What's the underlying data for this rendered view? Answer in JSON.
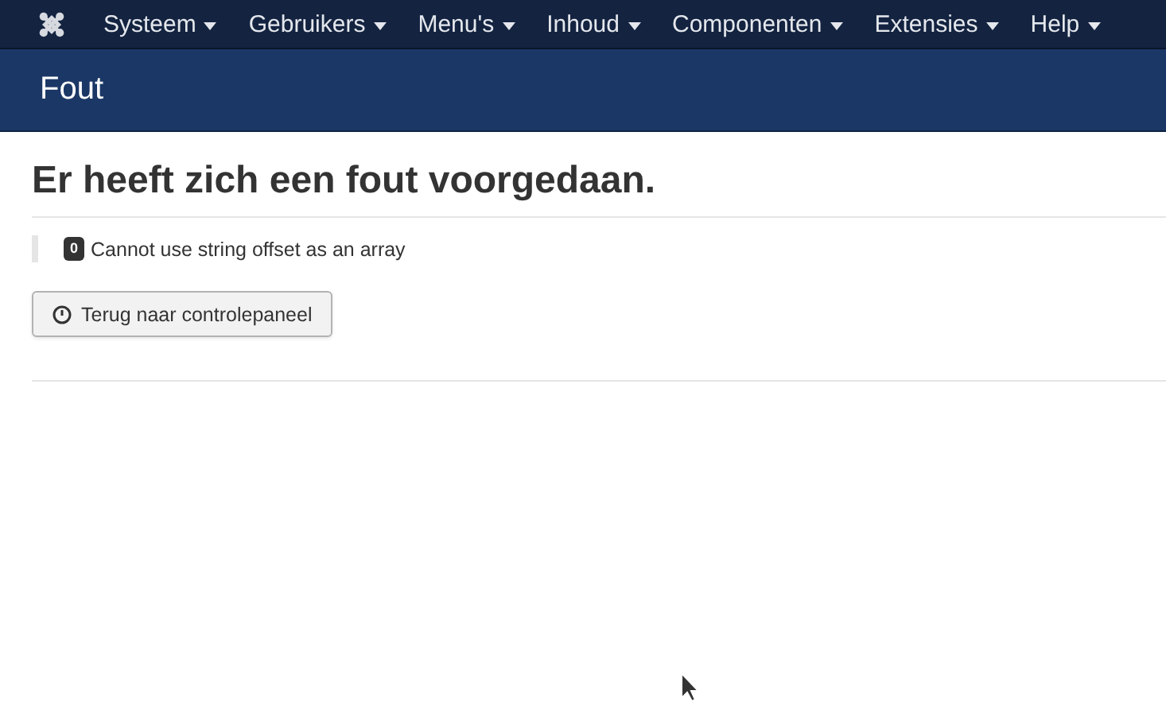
{
  "menu_bar": {
    "items": [
      {
        "label": "Systeem"
      },
      {
        "label": "Gebruikers"
      },
      {
        "label": "Menu's"
      },
      {
        "label": "Inhoud"
      },
      {
        "label": "Componenten"
      },
      {
        "label": "Extensies"
      },
      {
        "label": "Help"
      }
    ]
  },
  "header": {
    "title": "Fout"
  },
  "error": {
    "heading": "Er heeft zich een fout voorgedaan.",
    "code": "0",
    "message": "Cannot use string offset as an array"
  },
  "buttons": [
    {
      "label": "Terug naar controlepaneel"
    }
  ]
}
